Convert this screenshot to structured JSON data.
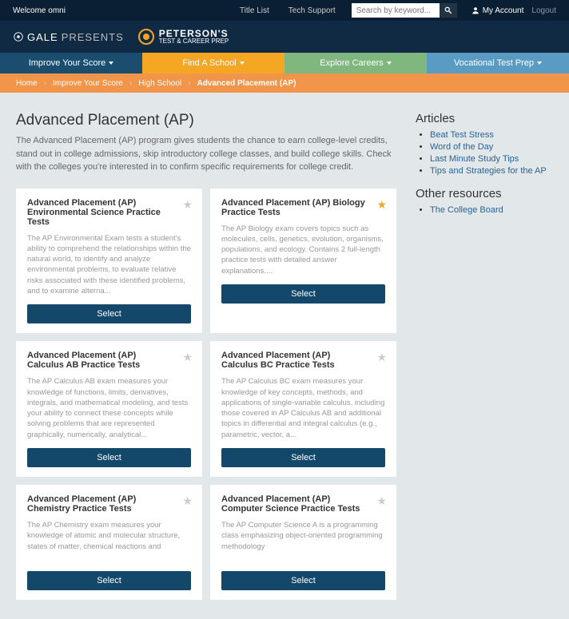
{
  "topbar": {
    "welcome": "Welcome omni",
    "title_list": "Title List",
    "tech_support": "Tech Support",
    "search_placeholder": "Search by keyword...",
    "my_account": "My Account",
    "logout": "Logout"
  },
  "brand": {
    "gale": "GALE",
    "presents": "PRESENTS",
    "peterson_big": "PETERSON'S",
    "peterson_small": "TEST & CAREER PREP"
  },
  "nav": {
    "t1": "Improve Your Score",
    "t2": "Find A School",
    "t3": "Explore Careers",
    "t4": "Vocational Test Prep"
  },
  "crumbs": {
    "c1": "Home",
    "c2": "Improve Your Score",
    "c3": "High School",
    "c4": "Advanced Placement (AP)"
  },
  "page": {
    "title": "Advanced Placement (AP)",
    "intro": "The Advanced Placement (AP) program gives students the chance to earn college-level credits, stand out in college admissions, skip introductory college classes, and build college skills. Check with the colleges you're interested in to confirm specific requirements for college credit.",
    "select": "Select"
  },
  "cards": [
    {
      "title": "Advanced Placement (AP) Environmental Science Practice Tests",
      "desc": "The AP Environmental Exam tests a student's ability to comprehend the relationships within the natural world, to identify and analyze environmental problems, to evaluate relative risks associated with these identified problems, and to examine alterna...",
      "fav": false
    },
    {
      "title": "Advanced Placement (AP) Biology Practice Tests",
      "desc": "The AP Biology exam covers topics such as molecules, cells, genetics, evolution, organisms, populations, and ecology. Contains 2 full-length practice tests with detailed answer explanations....",
      "fav": true
    },
    {
      "title": "Advanced Placement (AP) Calculus AB Practice Tests",
      "desc": "The AP Calculus AB exam measures your knowledge of functions, limits, derivatives, integrals, and mathematical modeling, and tests your ability to connect these concepts while solving problems that are represented graphically, numerically, analytical...",
      "fav": false
    },
    {
      "title": "Advanced Placement (AP) Calculus BC Practice Tests",
      "desc": "The AP Calculus BC exam measures your knowledge of key concepts, methods, and applications of single-variable calculus, including those covered in AP Calculus AB and additional topics in differential and integral calculus (e.g., parametric, vector, a...",
      "fav": false
    },
    {
      "title": "Advanced Placement (AP) Chemistry Practice Tests",
      "desc": "The AP Chemistry exam measures your knowledge of atomic and molecular structure, states of matter, chemical reactions and",
      "fav": false
    },
    {
      "title": "Advanced Placement (AP) Computer Science Practice Tests",
      "desc": "The AP Computer Science A is a programming class emphasizing object-oriented programming methodology",
      "fav": false
    }
  ],
  "sidebar": {
    "h1": "Articles",
    "articles": [
      "Beat Test Stress",
      "Word of the Day",
      "Last Minute Study Tips",
      "Tips and Strategies for the AP"
    ],
    "h2": "Other resources",
    "resources": [
      "The College Board"
    ]
  }
}
